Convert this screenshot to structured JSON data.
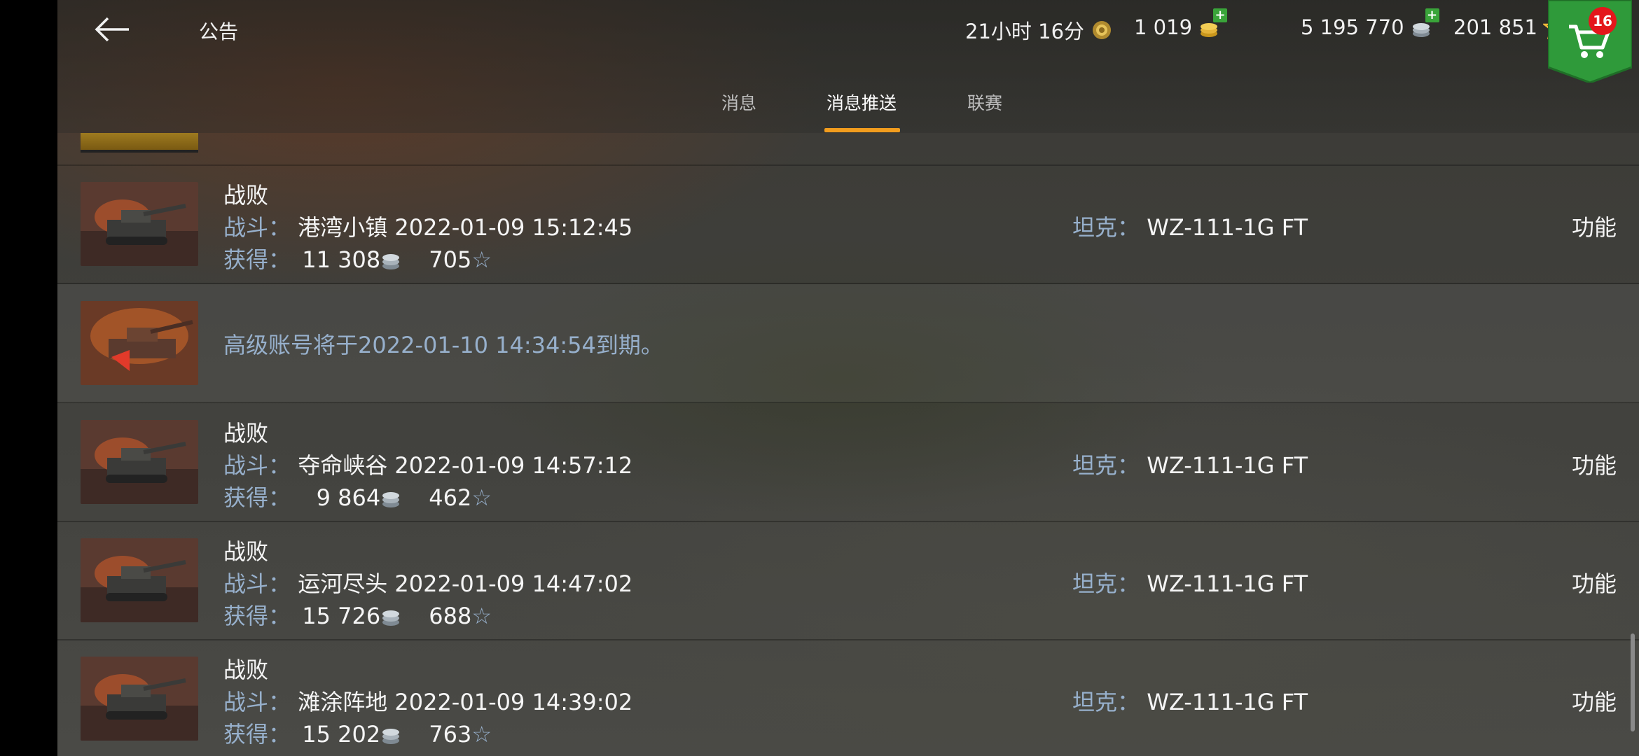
{
  "header": {
    "title": "公告",
    "timer": "21小时 16分",
    "gold": "1 019",
    "credits": "5 195 770",
    "free_xp": "201 851",
    "shop_badge": "16"
  },
  "tabs": [
    {
      "label": "消息"
    },
    {
      "label": "消息推送"
    },
    {
      "label": "联赛"
    }
  ],
  "active_tab": "消息推送",
  "labels": {
    "battle": "战斗：",
    "earned": "获得：",
    "tank": "坦克：",
    "function": "功能"
  },
  "rows": [
    {
      "result": "战败",
      "map_time": "港湾小镇 2022-01-09 15:12:45",
      "credits": "11 308",
      "xp": "705",
      "tank": "WZ-111-1G FT"
    },
    {
      "notice": "高级账号将于2022-01-10 14:34:54到期。"
    },
    {
      "result": "战败",
      "map_time": "夺命峡谷 2022-01-09 14:57:12",
      "credits": "9 864",
      "xp": "462",
      "tank": "WZ-111-1G FT"
    },
    {
      "result": "战败",
      "map_time": "运河尽头 2022-01-09 14:47:02",
      "credits": "15 726",
      "xp": "688",
      "tank": "WZ-111-1G FT"
    },
    {
      "result": "战败",
      "map_time": "滩涂阵地 2022-01-09 14:39:02",
      "credits": "15 202",
      "xp": "763",
      "tank": "WZ-111-1G FT"
    }
  ],
  "icons": {
    "back": "arrow-left-icon",
    "timer": "premium-laurel-icon",
    "gold": "gold-coins-icon",
    "credits": "silver-credits-icon",
    "xp": "star-icon",
    "shop": "cart-icon"
  },
  "colors": {
    "accent": "#f29d1e",
    "label": "#97b0cc",
    "badge": "#e4161b",
    "shop_green": "#2f9a3a"
  }
}
